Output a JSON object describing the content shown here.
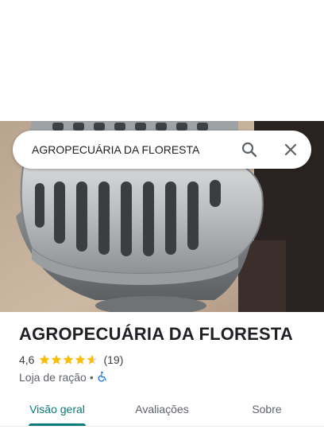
{
  "search": {
    "query": "AGROPECUÁRIA DA FLORESTA",
    "search_icon": "search-icon",
    "close_icon": "close-icon"
  },
  "place": {
    "title": "AGROPECUÁRIA DA FLORESTA",
    "rating": "4,6",
    "rating_value": 4.6,
    "stars_max": 5,
    "review_count": "(19)",
    "category": "Loja de ração",
    "separator": "•",
    "accessibility_icon": "wheelchair-icon"
  },
  "tabs": [
    {
      "label": "Visão geral",
      "active": true
    },
    {
      "label": "Avaliações",
      "active": false
    },
    {
      "label": "Sobre",
      "active": false
    }
  ],
  "colors": {
    "accent": "#0b7a7a",
    "star": "#fbbc04",
    "accessibility": "#1a73e8"
  }
}
